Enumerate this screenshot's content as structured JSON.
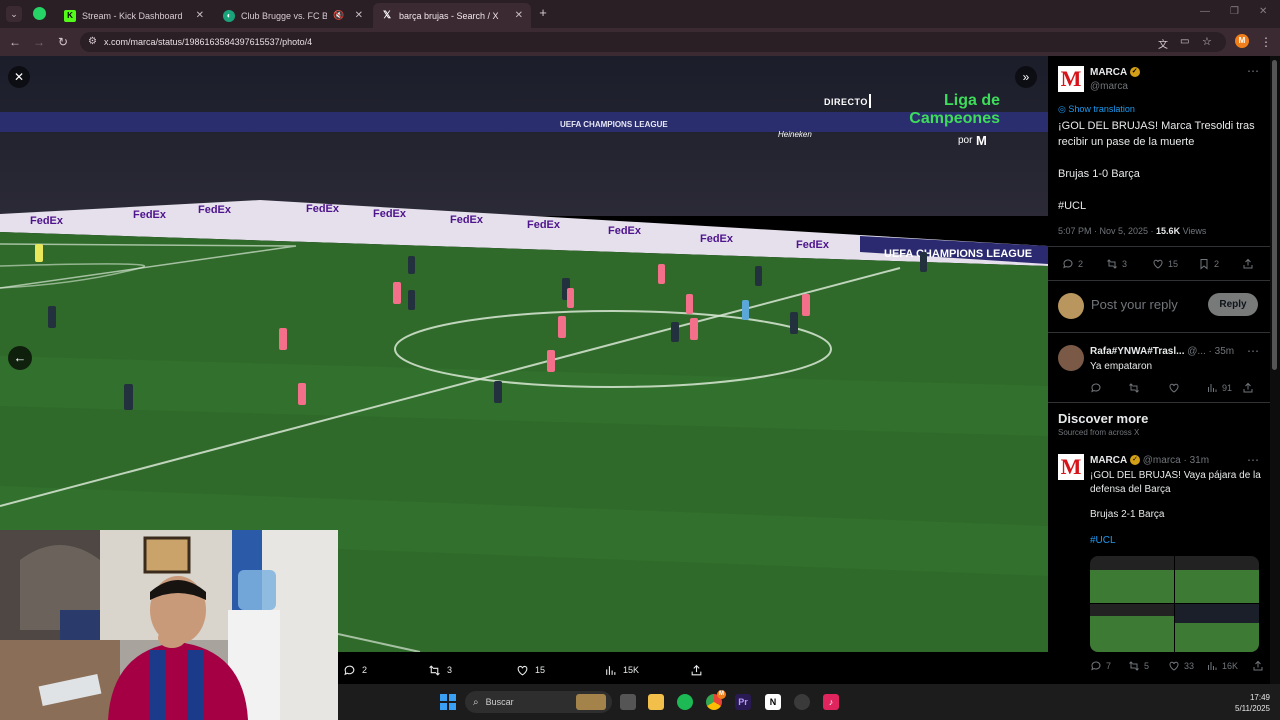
{
  "browser": {
    "tabs": [
      {
        "title": "Stream - Kick Dashboard",
        "active": false,
        "icon": "kick-icon"
      },
      {
        "title": "Club Brugge vs. FC Barcelo",
        "active": false,
        "icon": "sports-icon",
        "muted": true
      },
      {
        "title": "barça brujas - Search / X",
        "active": true,
        "icon": "x-icon"
      }
    ],
    "new_tab_label": "+",
    "url": "x.com/marca/status/1986163584397615537/photo/4",
    "profile_initial": "M"
  },
  "broadcast": {
    "live_label": "DIRECTO",
    "competition_line1": "Liga de",
    "competition_line2": "Campeones",
    "by_label": "por",
    "board_brand": "FedEx",
    "board_ucl": "UEFA CHAMPIONS LEAGUE",
    "stand_banner": "UEFA CHAMPIONS LEAGUE",
    "heineken": "Heineken"
  },
  "viewer_actions": {
    "replies": "2",
    "reposts": "3",
    "likes": "15",
    "views": "15K"
  },
  "tweet": {
    "author": "MARCA",
    "handle": "@marca",
    "show_translation": "Show translation",
    "text_line1": "¡GOL DEL BRUJAS! Marca Tresoldi tras recibir un pase de la muerte",
    "text_line2": "Brujas 1-0 Barça",
    "hashtag": "#UCL",
    "time": "5:07 PM · Nov 5, 2025 · ",
    "views_count": "15.6K",
    "views_label": " Views",
    "stats": {
      "replies": "2",
      "reposts": "3",
      "likes": "15",
      "bookmarks": "2"
    }
  },
  "reply_box": {
    "placeholder": "Post your reply",
    "button": "Reply"
  },
  "reply": {
    "name": "Rafa#YNWA#Trasl...",
    "handle": "@...",
    "time": "· 35m",
    "text": "Ya empataron",
    "views": "91"
  },
  "discover": {
    "title": "Discover more",
    "subtitle": "Sourced from across X",
    "post": {
      "author": "MARCA",
      "meta": "@marca · 31m",
      "text_line1": "¡GOL DEL BRUJAS! Vaya pájara de la defensa del Barça",
      "text_line2": "Brujas 2-1 Barça",
      "hashtag": "#UCL",
      "replies": "7",
      "reposts": "5",
      "likes": "33",
      "views": "16K"
    }
  },
  "taskbar": {
    "search_label": "Buscar",
    "time": "17:49",
    "date": "5/11/2025",
    "chrome_badge": "M"
  },
  "colors": {
    "x_blue": "#1d9bf0",
    "marca_red": "#d7141a",
    "pitch_green": "#2f6a2a",
    "broadcast_green": "#3ddc5a"
  }
}
